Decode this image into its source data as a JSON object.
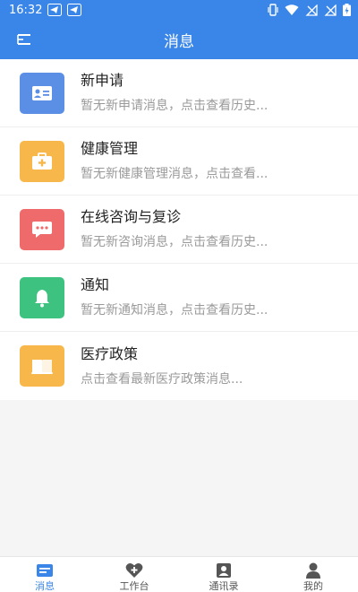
{
  "status_bar": {
    "time": "16:32"
  },
  "header": {
    "title": "消息"
  },
  "messages": [
    {
      "title": "新申请",
      "subtitle": "暂无新申请消息，点击查看历史...",
      "icon": "id-card-icon",
      "color": "#5b8fe6"
    },
    {
      "title": "健康管理",
      "subtitle": "暂无新健康管理消息，点击查看...",
      "icon": "medical-kit-icon",
      "color": "#f7b74a"
    },
    {
      "title": "在线咨询与复诊",
      "subtitle": "暂无新咨询消息，点击查看历史...",
      "icon": "chat-bubble-icon",
      "color": "#ef6b6b"
    },
    {
      "title": "通知",
      "subtitle": "暂无新通知消息，点击查看历史...",
      "icon": "bell-icon",
      "color": "#3ec27f"
    },
    {
      "title": "医疗政策",
      "subtitle": "点击查看最新医疗政策消息...",
      "icon": "book-icon",
      "color": "#f7b74a"
    }
  ],
  "bottom_nav": [
    {
      "label": "消息",
      "icon": "message-icon",
      "active": true
    },
    {
      "label": "工作台",
      "icon": "workbench-icon",
      "active": false
    },
    {
      "label": "通讯录",
      "icon": "contacts-icon",
      "active": false
    },
    {
      "label": "我的",
      "icon": "profile-icon",
      "active": false
    }
  ],
  "colors": {
    "primary": "#3a86e8",
    "nav_inactive": "#555555"
  }
}
